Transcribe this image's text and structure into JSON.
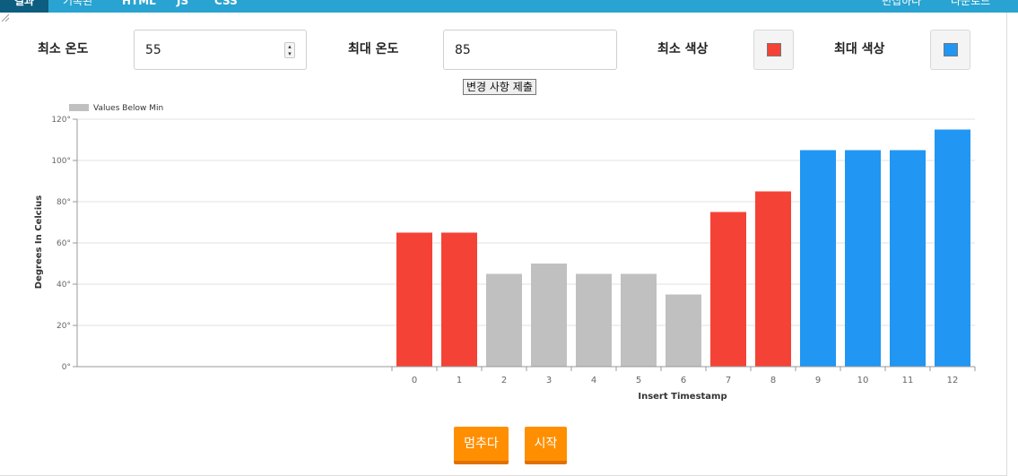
{
  "nav": {
    "tabs": [
      "결과",
      "기록된",
      "HTML",
      "JS",
      "CSS"
    ],
    "right_links": [
      "편집하다",
      "다운로드"
    ]
  },
  "controls": {
    "min_temp_label": "최소 온도",
    "min_temp_value": "55",
    "max_temp_label": "최대 온도",
    "max_temp_value": "85",
    "min_color_label": "최소 색상",
    "max_color_label": "최대 색상",
    "submit_label": "변경 사항 제출"
  },
  "buttons": {
    "stop": "멈추다",
    "start": "시작"
  },
  "colors": {
    "min": "#f44336",
    "max": "#2196f3",
    "below": "#c0c0c0",
    "nav": "#29a3d1",
    "action": "#ff8f00"
  },
  "chart_data": {
    "type": "bar",
    "title": "",
    "xlabel": "Insert Timestamp",
    "ylabel": "Degrees In Celcius",
    "categories": [
      "0",
      "1",
      "2",
      "3",
      "4",
      "5",
      "6",
      "7",
      "8",
      "9",
      "10",
      "11",
      "12"
    ],
    "values": [
      65,
      65,
      45,
      50,
      45,
      45,
      35,
      75,
      85,
      105,
      105,
      105,
      115
    ],
    "bar_colors": [
      "#f44336",
      "#f44336",
      "#c0c0c0",
      "#c0c0c0",
      "#c0c0c0",
      "#c0c0c0",
      "#c0c0c0",
      "#f44336",
      "#f44336",
      "#2196f3",
      "#2196f3",
      "#2196f3",
      "#2196f3"
    ],
    "ylim": [
      0,
      120
    ],
    "yticks": [
      "0°",
      "20°",
      "40°",
      "60°",
      "80°",
      "100°",
      "120°"
    ],
    "grid": true,
    "legend": [
      {
        "name": "Values Below Min",
        "color": "#c0c0c0"
      }
    ],
    "legend_position": "top-left"
  }
}
